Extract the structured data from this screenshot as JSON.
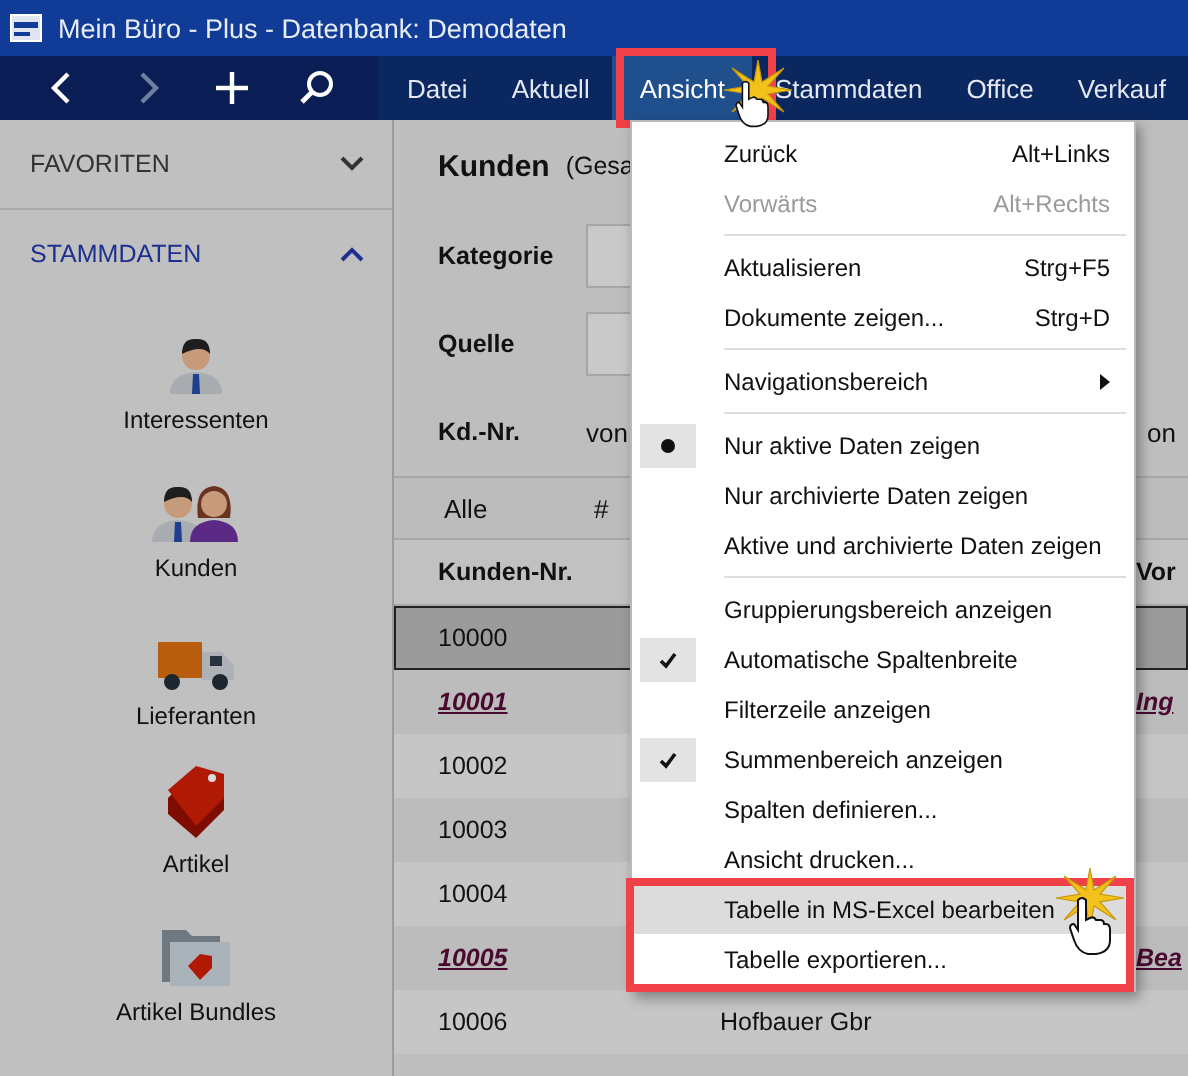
{
  "window": {
    "title": "Mein Büro - Plus - Datenbank: Demodaten"
  },
  "toolbar": [
    {
      "kind": "back",
      "disabled": false
    },
    {
      "kind": "forward",
      "disabled": true
    },
    {
      "kind": "add",
      "disabled": false
    },
    {
      "kind": "search",
      "disabled": false
    }
  ],
  "menu_bar": [
    {
      "label": "Datei",
      "selected": false
    },
    {
      "label": "Aktuell",
      "selected": false
    },
    {
      "label": "Ansicht",
      "selected": true
    },
    {
      "label": "Stammdaten",
      "selected": false
    },
    {
      "label": "Office",
      "selected": false
    },
    {
      "label": "Verkauf",
      "selected": false
    }
  ],
  "sidebar": {
    "sections": [
      {
        "label": "FAVORITEN",
        "expanded": false
      },
      {
        "label": "STAMMDATEN",
        "expanded": true
      }
    ],
    "items": [
      {
        "label": "Interessenten",
        "kind": "person"
      },
      {
        "label": "Kunden",
        "kind": "people"
      },
      {
        "label": "Lieferanten",
        "kind": "truck"
      },
      {
        "label": "Artikel",
        "kind": "tag"
      },
      {
        "label": "Artikel Bundles",
        "kind": "bundle"
      }
    ]
  },
  "page": {
    "title": "Kunden",
    "subtitle": "(Gesa"
  },
  "filters": [
    {
      "label": "Kategorie",
      "kind": "dropdown"
    },
    {
      "label": "Quelle",
      "kind": "dropdown"
    },
    {
      "label": "Kd.-Nr.",
      "kind": "range",
      "from": "von",
      "to": "on"
    }
  ],
  "group_bar": {
    "label": "Alle",
    "count_header": "#"
  },
  "table": {
    "columns": [
      "Kunden-Nr.",
      "Vor"
    ],
    "rows": [
      {
        "kunden_nr": "10000",
        "link": false,
        "selected": true
      },
      {
        "kunden_nr": "10001",
        "link": true,
        "selected": false,
        "column_3": "Ing"
      },
      {
        "kunden_nr": "10002",
        "link": false,
        "selected": false
      },
      {
        "kunden_nr": "10003",
        "link": false,
        "selected": false
      },
      {
        "kunden_nr": "10004",
        "link": false,
        "selected": false
      },
      {
        "kunden_nr": "10005",
        "link": true,
        "selected": false,
        "column_3": "Bea"
      },
      {
        "kunden_nr": "10006",
        "link": false,
        "selected": false,
        "column_2": "Hofbauer Gbr"
      }
    ]
  },
  "dropdown_menu": [
    {
      "kind": "command",
      "label": "Zurück",
      "shortcut": "Alt+Links",
      "disabled": false,
      "hovered": false
    },
    {
      "kind": "command",
      "label": "Vorwärts",
      "shortcut": "Alt+Rechts",
      "disabled": true,
      "hovered": false
    },
    {
      "kind": "separator"
    },
    {
      "kind": "command",
      "label": "Aktualisieren",
      "shortcut": "Strg+F5",
      "disabled": false,
      "hovered": false
    },
    {
      "kind": "command",
      "label": "Dokumente zeigen...",
      "shortcut": "Strg+D",
      "disabled": false,
      "hovered": false
    },
    {
      "kind": "separator"
    },
    {
      "kind": "submenu",
      "label": "Navigationsbereich",
      "disabled": false,
      "hovered": false
    },
    {
      "kind": "separator"
    },
    {
      "kind": "radio",
      "label": "Nur aktive Daten zeigen",
      "selected": true,
      "disabled": false,
      "hovered": false
    },
    {
      "kind": "radio",
      "label": "Nur archivierte Daten zeigen",
      "selected": false,
      "disabled": false,
      "hovered": false
    },
    {
      "kind": "radio",
      "label": "Aktive und archivierte Daten zeigen",
      "selected": false,
      "disabled": false,
      "hovered": false
    },
    {
      "kind": "separator"
    },
    {
      "kind": "toggle",
      "label": "Gruppierungsbereich anzeigen",
      "checked": false,
      "disabled": false,
      "hovered": false
    },
    {
      "kind": "toggle",
      "label": "Automatische Spaltenbreite",
      "checked": true,
      "disabled": false,
      "hovered": false
    },
    {
      "kind": "toggle",
      "label": "Filterzeile anzeigen",
      "checked": false,
      "disabled": false,
      "hovered": false
    },
    {
      "kind": "toggle",
      "label": "Summenbereich anzeigen",
      "checked": true,
      "disabled": false,
      "hovered": false
    },
    {
      "kind": "command",
      "label": "Spalten definieren...",
      "disabled": false,
      "hovered": false
    },
    {
      "kind": "command",
      "label": "Ansicht drucken...",
      "disabled": false,
      "hovered": false
    },
    {
      "kind": "command",
      "label": "Tabelle in MS-Excel bearbeiten",
      "disabled": false,
      "hovered": true
    },
    {
      "kind": "command",
      "label": "Tabelle exportieren...",
      "disabled": false,
      "hovered": false
    }
  ]
}
